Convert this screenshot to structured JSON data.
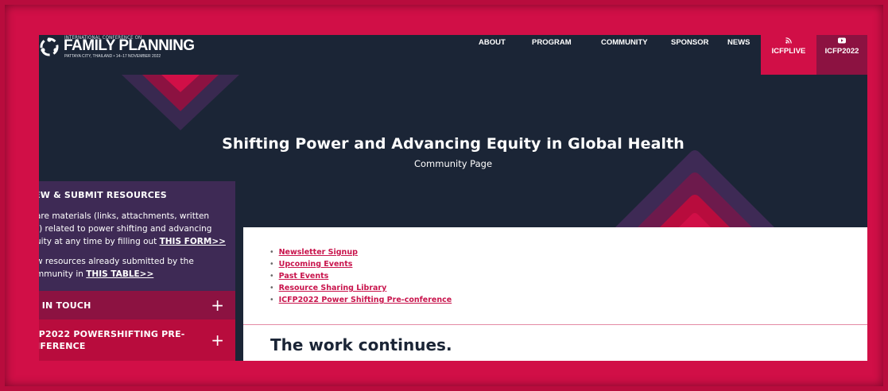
{
  "header": {
    "logo_top": "INTERNATIONAL CONFERENCE ON",
    "logo_main": "FAMILY PLANNING",
    "logo_sub": "PATTAYA CITY, THAILAND • 14–17 NOVEMBER 2022",
    "nav": [
      "ABOUT",
      "PROGRAM",
      "COMMUNITY",
      "SPONSOR",
      "NEWS"
    ],
    "live_label": "ICFPLIVE",
    "yt_label": "ICFP2022"
  },
  "hero": {
    "title": "Shifting Power and Advancing Equity in Global Health",
    "subtitle": "Community Page"
  },
  "sidebar": {
    "heading": "EW & SUBMIT RESOURCES",
    "p1_lines": [
      "are materials (links, attachments, written",
      "t) related to power shifting and advancing",
      "uity at any time by filling out "
    ],
    "p1_link": "THIS FORM>>",
    "p2_lines": [
      "w resources already submitted by the",
      "mmunity in "
    ],
    "p2_link": "THIS TABLE>>",
    "acc1_label": "T IN TOUCH",
    "acc2_label_1": "FP2022 POWERSHIFTING PRE-",
    "acc2_label_2": "NFERENCE",
    "plus": "+"
  },
  "main": {
    "links": [
      "Newsletter Signup",
      "Upcoming Events",
      "Past Events",
      "Resource Sharing Library",
      "ICFP2022 Power Shifting Pre-conference"
    ],
    "heading": "The work continues."
  },
  "colors": {
    "navy": "#1b2536",
    "crimson": "#d10f47",
    "plum": "#3e2a55",
    "maroon": "#8c1241"
  }
}
